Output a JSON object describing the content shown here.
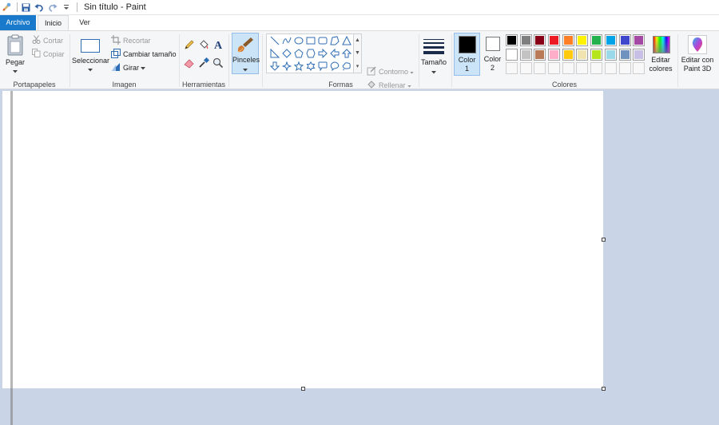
{
  "window": {
    "title": "Sin título - Paint"
  },
  "tabs": {
    "file": "Archivo",
    "home": "Inicio",
    "view": "Ver"
  },
  "clipboard": {
    "paste": "Pegar",
    "cut": "Cortar",
    "copy": "Copiar",
    "label": "Portapapeles"
  },
  "image": {
    "select": "Seleccionar",
    "crop": "Recortar",
    "resize": "Cambiar tamaño",
    "rotate": "Girar",
    "label": "Imagen"
  },
  "tools": {
    "label": "Herramientas"
  },
  "brushes": {
    "label": "Pinceles"
  },
  "shapes": {
    "outline": "Contorno",
    "fill": "Rellenar",
    "label": "Formas"
  },
  "size": {
    "label": "Tamaño"
  },
  "colors": {
    "color1": "Color 1",
    "color2": "Color 2",
    "color1_value": "#000000",
    "color2_value": "#ffffff",
    "edit": "Editar colores",
    "label": "Colores",
    "palette": [
      "#000000",
      "#7f7f7f",
      "#880015",
      "#ed1c24",
      "#ff7f27",
      "#fff200",
      "#22b14c",
      "#00a2e8",
      "#3f48cc",
      "#a349a4",
      "#ffffff",
      "#c3c3c3",
      "#b97a57",
      "#ffaec9",
      "#ffc90e",
      "#efe4b0",
      "#b5e61d",
      "#99d9ea",
      "#7092be",
      "#c8bfe7"
    ]
  },
  "paint3d": {
    "label": "Editar con Paint 3D"
  }
}
